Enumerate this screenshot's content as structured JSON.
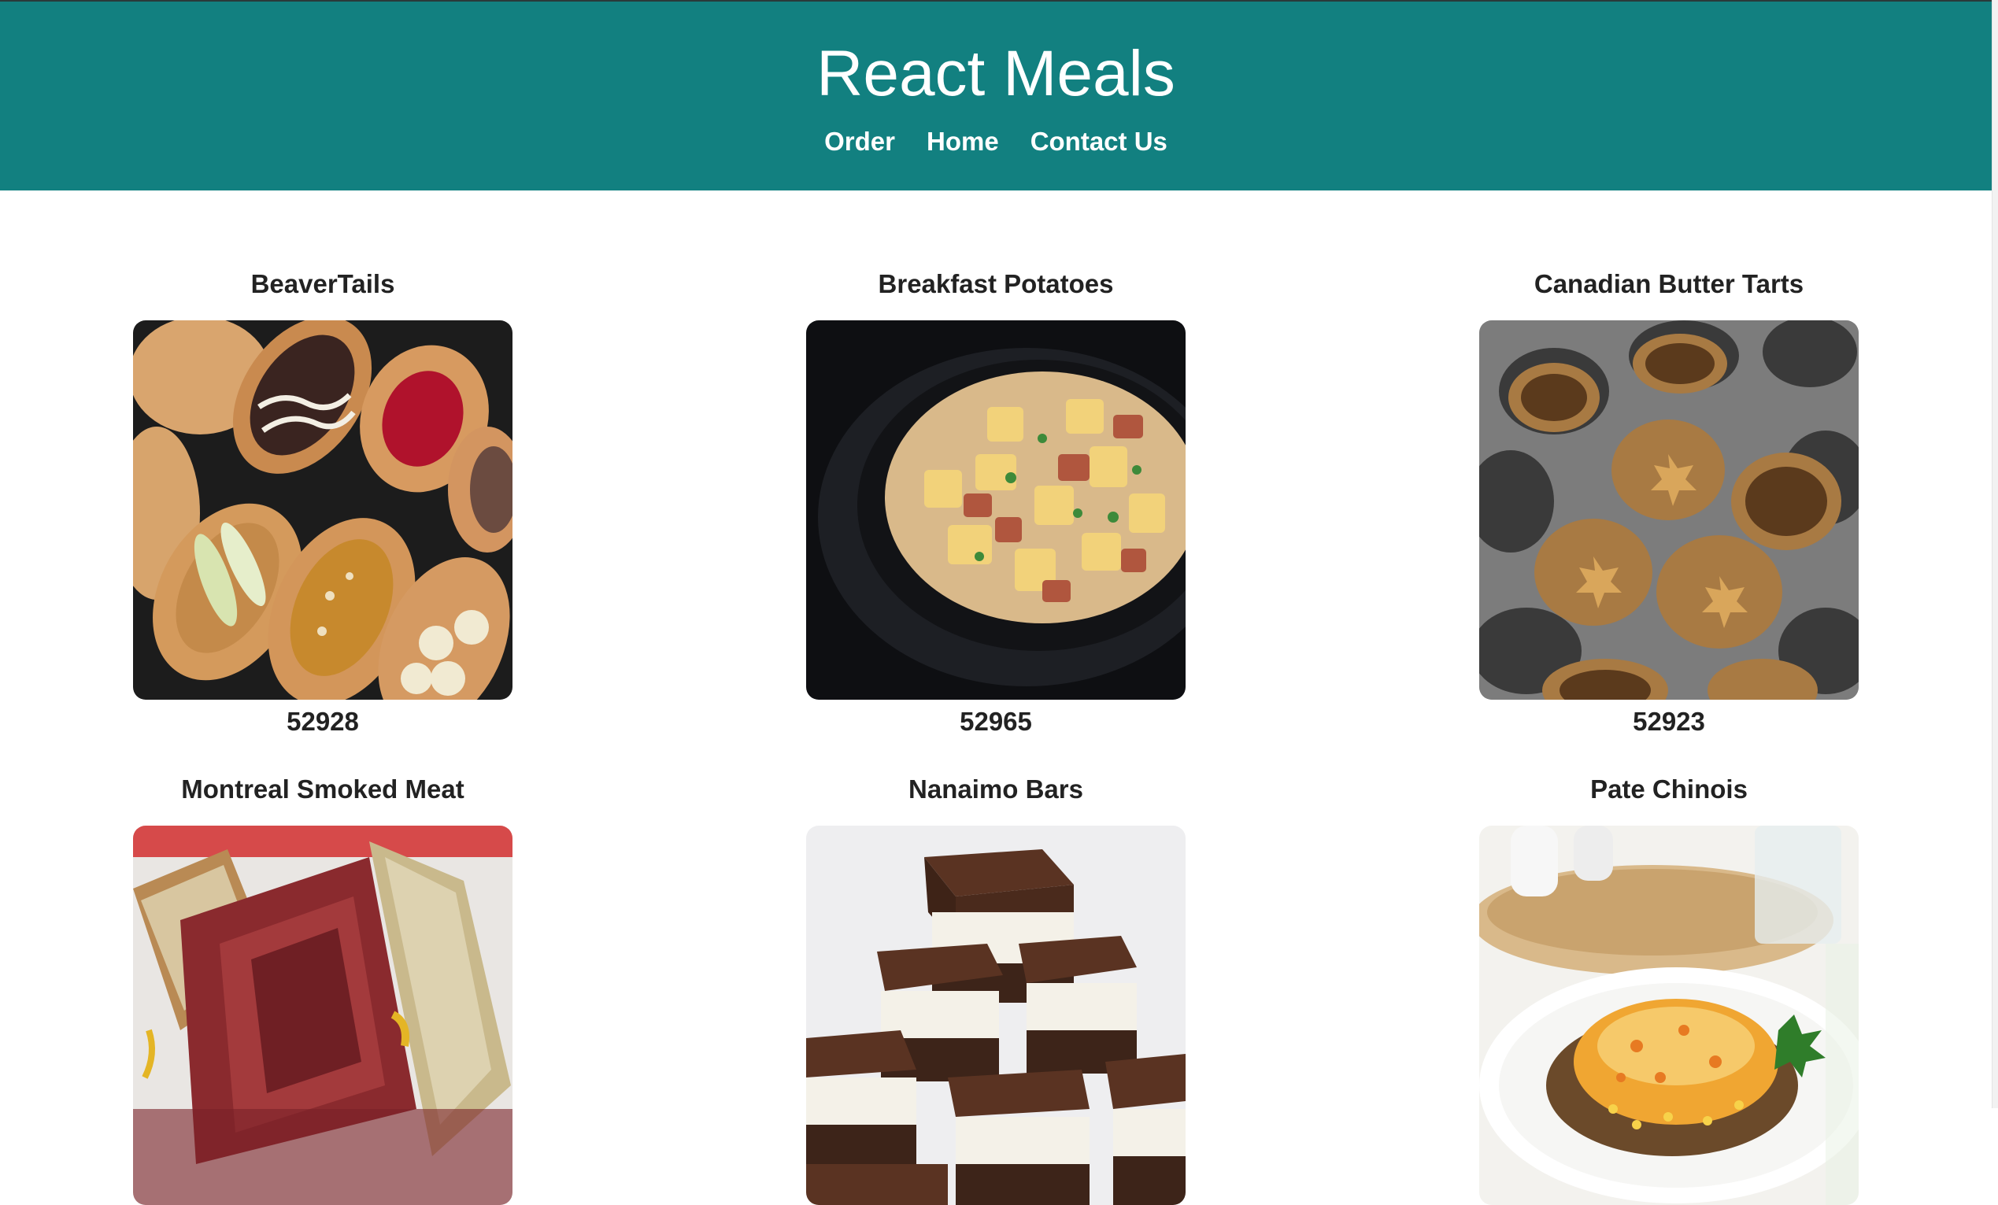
{
  "app": {
    "title": "React Meals"
  },
  "nav": {
    "items": [
      {
        "label": "Order"
      },
      {
        "label": "Home"
      },
      {
        "label": "Contact Us"
      }
    ]
  },
  "meals": [
    {
      "name": "BeaverTails",
      "id": "52928",
      "photo_icon": "beavertails-photo"
    },
    {
      "name": "Breakfast Potatoes",
      "id": "52965",
      "photo_icon": "breakfast-potatoes-photo"
    },
    {
      "name": "Canadian Butter Tarts",
      "id": "52923",
      "photo_icon": "butter-tarts-photo"
    },
    {
      "name": "Montreal Smoked Meat",
      "photo_icon": "smoked-meat-photo"
    },
    {
      "name": "Nanaimo Bars",
      "photo_icon": "nanaimo-bars-photo"
    },
    {
      "name": "Pate Chinois",
      "photo_icon": "pate-chinois-photo"
    }
  ],
  "colors": {
    "header_bg": "#128080",
    "header_text": "#ffffff",
    "body_text": "#222222"
  }
}
